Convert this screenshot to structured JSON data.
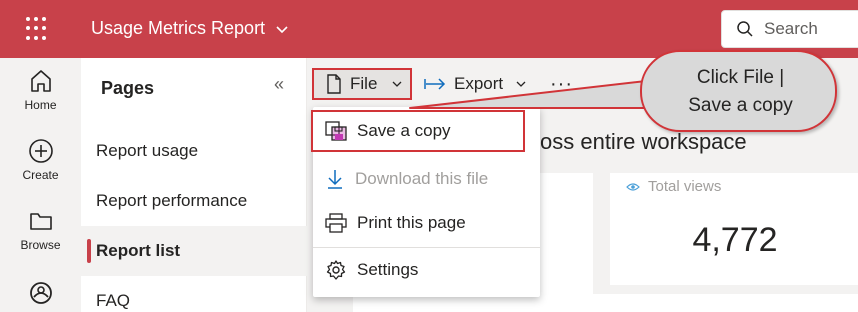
{
  "topbar": {
    "app_title": "Usage Metrics Report",
    "search_placeholder": "Search",
    "accent_color": "#c8414a"
  },
  "leftnav": {
    "items": [
      {
        "label": "Home",
        "icon": "home-icon"
      },
      {
        "label": "Create",
        "icon": "plus-circle-icon"
      },
      {
        "label": "Browse",
        "icon": "folder-icon"
      },
      {
        "label": "",
        "icon": "onelake-icon"
      }
    ]
  },
  "pages": {
    "title": "Pages",
    "collapse_glyph": "«",
    "items": [
      {
        "label": "Report usage",
        "active": false
      },
      {
        "label": "Report performance",
        "active": false
      },
      {
        "label": "Report list",
        "active": true
      },
      {
        "label": "FAQ",
        "active": false
      }
    ]
  },
  "toolbar": {
    "file_label": "File",
    "export_label": "Export",
    "more_label": "···"
  },
  "file_menu": {
    "items": [
      {
        "label": "Save a copy",
        "icon": "save-copy-icon",
        "enabled": true,
        "highlighted": true
      },
      {
        "label": "Download this file",
        "icon": "download-icon",
        "enabled": false
      },
      {
        "label": "Print this page",
        "icon": "print-icon",
        "enabled": true
      },
      {
        "label": "Settings",
        "icon": "gear-icon",
        "enabled": true
      }
    ]
  },
  "report": {
    "heading": "oss entire workspace",
    "total_views_label": "Total views",
    "total_views_value": "4,772"
  },
  "callout": {
    "line1": "Click File |",
    "line2": "Save a copy",
    "border_color": "#d13438"
  }
}
